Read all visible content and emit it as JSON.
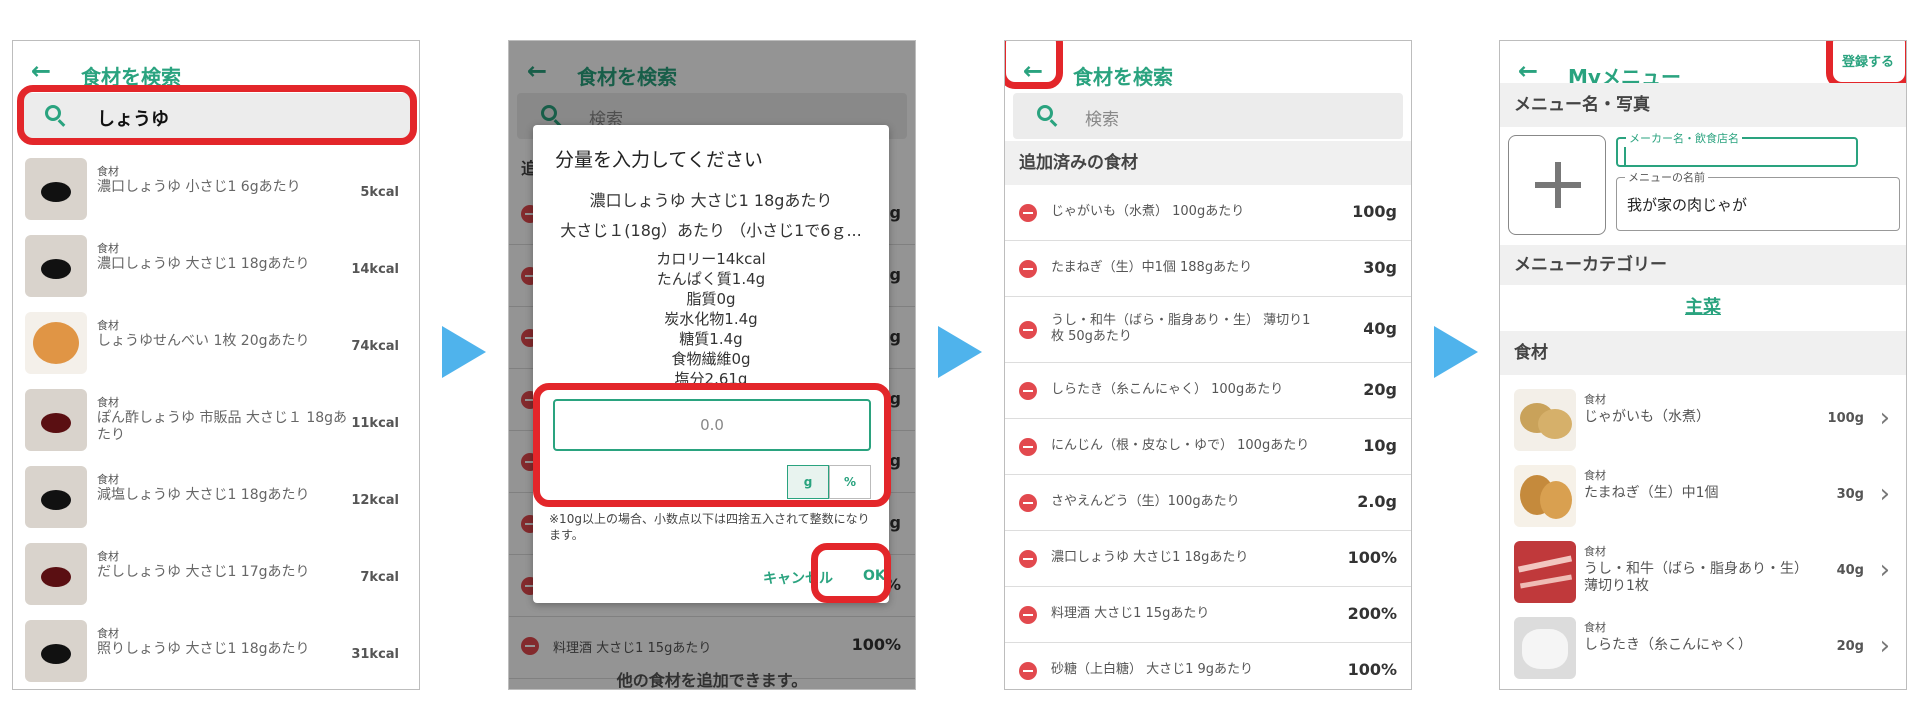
{
  "colors": {
    "accent": "#2aa37f",
    "highlight": "#e3262a",
    "arrow": "#4fb3ec",
    "minus": "#e2494e"
  },
  "screen1": {
    "back_icon": "←",
    "title": "食材を検索",
    "search_value": "しょうゆ",
    "items": [
      {
        "category": "食材",
        "name": "濃口しょうゆ 小さじ1 6gあたり",
        "kcal": "5kcal"
      },
      {
        "category": "食材",
        "name": "濃口しょうゆ 大さじ1 18gあたり",
        "kcal": "14kcal"
      },
      {
        "category": "食材",
        "name": "しょうゆせんべい 1枚 20gあたり",
        "kcal": "74kcal"
      },
      {
        "category": "食材",
        "name": "ぽん酢しょうゆ 市販品 大さじ１ 18gあたり",
        "kcal": "11kcal"
      },
      {
        "category": "食材",
        "name": "減塩しょうゆ 大さじ1 18gあたり",
        "kcal": "12kcal"
      },
      {
        "category": "食材",
        "name": "だししょうゆ 大さじ1 17gあたり",
        "kcal": "7kcal"
      },
      {
        "category": "食材",
        "name": "照りしょうゆ 大さじ1 18gあたり",
        "kcal": "31kcal"
      }
    ]
  },
  "screen2": {
    "back_icon": "←",
    "title": "食材を検索",
    "search_placeholder": "検索",
    "dialog": {
      "title": "分量を入力してください",
      "food": "濃口しょうゆ 大さじ1 18gあたり",
      "portion": "大さじ１(18g）あたり （小さじ1で6ｇ...",
      "nutrition": [
        "カロリー14kcal",
        "たんぱく質1.4g",
        "脂質0g",
        "炭水化物1.4g",
        "糖質1.4g",
        "食物繊維0g",
        "塩分2.61g"
      ],
      "quantity_placeholder": "0.0",
      "unit_g": "g",
      "unit_pct": "%",
      "note": "※10g以上の場合、小数点以下は四捨五入されて整数になります。",
      "cancel": "キャンセル",
      "ok": "OK"
    },
    "bg_peek": {
      "section": "追",
      "bg_unit": "g",
      "bg_pct": "%"
    },
    "bg_last_item": {
      "name": "料理酒 大さじ1 15gあたり",
      "amount": "100%"
    },
    "bg_footer": "他の食材を追加できます。"
  },
  "screen3": {
    "back_icon": "←",
    "title": "食材を検索",
    "search_placeholder": "検索",
    "section": "追加済みの食材",
    "items": [
      {
        "name": "じゃがいも（水煮） 100gあたり",
        "amount": "100g"
      },
      {
        "name": "たまねぎ（生）中1個 188gあたり",
        "amount": "30g"
      },
      {
        "name": "うし・和牛（ばら・脂身あり・生） 薄切り1枚 50gあたり",
        "amount": "40g"
      },
      {
        "name": "しらたき（糸こんにゃく） 100gあたり",
        "amount": "20g"
      },
      {
        "name": "にんじん（根・皮なし・ゆで） 100gあたり",
        "amount": "10g"
      },
      {
        "name": "さやえんどう（生）100gあたり",
        "amount": "2.0g"
      },
      {
        "name": "濃口しょうゆ 大さじ1 18gあたり",
        "amount": "100%"
      },
      {
        "name": "料理酒 大さじ1 15gあたり",
        "amount": "200%"
      },
      {
        "name": "砂糖（上白糖） 大さじ1 9gあたり",
        "amount": "100%"
      }
    ]
  },
  "screen4": {
    "back_icon": "←",
    "title": "Myメニュー",
    "register": "登録する",
    "section_name_photo": "メニュー名・写真",
    "maker_label": "メーカー名・飲食店名",
    "maker_value": "",
    "menu_name_label": "メニューの名前",
    "menu_name_value": "我が家の肉じゃが",
    "section_category": "メニューカテゴリー",
    "category_value": "主菜",
    "section_ingredients": "食材",
    "items": [
      {
        "category": "食材",
        "name": "じゃがいも（水煮）",
        "amount": "100g"
      },
      {
        "category": "食材",
        "name": "たまねぎ（生）中1個",
        "amount": "30g"
      },
      {
        "category": "食材",
        "name": "うし・和牛（ばら・脂身あり・生） 薄切り1枚",
        "amount": "40g"
      },
      {
        "category": "食材",
        "name": "しらたき（糸こんにゃく）",
        "amount": "20g"
      }
    ]
  }
}
